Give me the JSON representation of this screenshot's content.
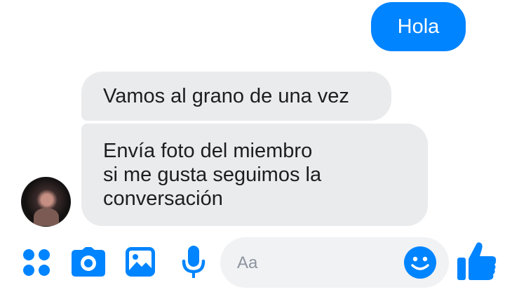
{
  "messages": {
    "sent": [
      "Hola"
    ],
    "received": [
      {
        "lines": [
          "Vamos al grano de una vez"
        ]
      },
      {
        "lines": [
          "Envía foto del miembro",
          "si me gusta seguimos la",
          "conversación"
        ]
      }
    ]
  },
  "composer": {
    "placeholder": "Aa"
  },
  "icons": {
    "more": "four-dots-icon",
    "camera": "camera-icon",
    "gallery": "image-icon",
    "mic": "microphone-icon",
    "emoji": "smiley-icon",
    "like": "thumbs-up-icon"
  },
  "colors": {
    "accent": "#0084ff",
    "received_bubble": "#eaebed",
    "composer_bg": "#f1f2f4"
  }
}
